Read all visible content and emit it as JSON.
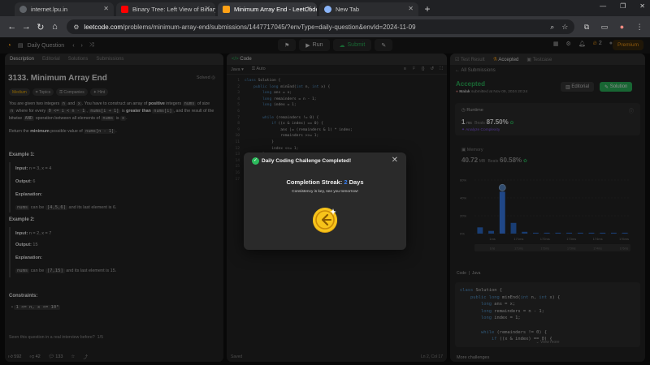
{
  "browser": {
    "tabs": [
      {
        "label": "internet.lpu.in",
        "icon": "globe-icon",
        "color": "#5f6368"
      },
      {
        "label": "Binary Tree: Left View of Binary",
        "icon": "youtube-icon",
        "color": "#ff0000"
      },
      {
        "label": "Minimum Array End - LeetCode",
        "icon": "leetcode-icon",
        "color": "#ffa116",
        "active": true
      },
      {
        "label": "New Tab",
        "icon": "chrome-icon",
        "color": "#8ab4f8"
      }
    ],
    "url_host": "leetcode.com",
    "url_path": "/problems/minimum-array-end/submissions/1447717045/?envType=daily-question&envId=2024-11-09"
  },
  "lc_header": {
    "daily_label": "Daily Question",
    "run_label": "Run",
    "submit_label": "Submit",
    "streak_count": "2",
    "premium_label": "Premium"
  },
  "left_panel": {
    "tabs": [
      "Description",
      "Editorial",
      "Solutions",
      "Submissions"
    ],
    "title": "3133. Minimum Array End",
    "solved_label": "Solved",
    "tags": [
      "Medium",
      "Topics",
      "Companies",
      "Hint"
    ],
    "para1_a": "You are given two integers ",
    "para1_n": "n",
    "para1_b": " and ",
    "para1_x": "x",
    "para1_c": ". You have to construct an array of ",
    "para1_pos": "positive",
    "para1_d": " integers ",
    "para1_nums": "nums",
    "para1_e": " of size ",
    "para1_f": " where for every ",
    "para1_range": "0 <= i < n - 1",
    "para1_g": ", ",
    "para1_ni1": "nums[i + 1]",
    "para1_h": " is ",
    "para1_gt": "greater than",
    "para1_ni": "nums[i]",
    "para1_i": ", and the result of the bitwise ",
    "para1_and": "AND",
    "para1_j": " operation between all elements of ",
    "para1_k": " is ",
    "para1_l": ".",
    "para2_a": "Return the ",
    "para2_min": "minimum",
    "para2_b": " possible value of ",
    "para2_code": "nums[n - 1]",
    "para2_c": ".",
    "ex1_title": "Example 1:",
    "ex1_input_label": "Input:",
    "ex1_input": "n = 3, x = 4",
    "ex1_output_label": "Output:",
    "ex1_output": "6",
    "ex1_expl_label": "Explanation:",
    "ex1_expl_code1": "nums",
    "ex1_expl_mid": " can be ",
    "ex1_expl_code2": "[4,5,6]",
    "ex1_expl_end": " and its last element is 6.",
    "ex2_title": "Example 2:",
    "ex2_input_label": "Input:",
    "ex2_input": "n = 2, x = 7",
    "ex2_output_label": "Output:",
    "ex2_output": "15",
    "ex2_expl_label": "Explanation:",
    "ex2_expl_code1": "nums",
    "ex2_expl_mid": " can be ",
    "ex2_expl_code2": "[7,15]",
    "ex2_expl_end": " and its last element is 15.",
    "constraints_title": "Constraints:",
    "constraint1": "1 <= n, x <= 10⁸",
    "interview_q": "Seen this question in a real interview before?",
    "interview_page": "1/5",
    "likes": "592",
    "dislikes": "42",
    "comments": "133"
  },
  "mid_panel": {
    "tab_label": "Code",
    "lang": "Java",
    "auto": "Auto",
    "code": [
      "class Solution {",
      "    public long minEnd(int n, int x) {",
      "        long ans = x;",
      "        long remainders = n - 1;",
      "        long index = 1;",
      "",
      "        while (remainders != 0) {",
      "            if ((x & index) == 0) {",
      "                ans |= (remainders & 1) * index;",
      "                remainders >>= 1;",
      "            }",
      "            index <<= 1;",
      "        }",
      "",
      "        return ans;",
      "    }",
      "}"
    ],
    "saved": "Saved",
    "cursor": "Ln 2, Col 17"
  },
  "right_panel": {
    "tabs": [
      "Test Result",
      "Accepted",
      "Testcase"
    ],
    "back_label": "All Submissions",
    "status": "Accepted",
    "author": "Malak",
    "submitted": "submitted at Nov 09, 2024 20:24",
    "editorial_label": "Editorial",
    "solution_label": "Solution",
    "runtime_label": "Runtime",
    "runtime_value": "1",
    "runtime_unit": "ms",
    "beats_label": "Beats",
    "beats_value": "87.50%",
    "analyze_label": "Analyze Complexity",
    "memory_label": "Memory",
    "memory_value": "40.72",
    "memory_unit": "MB",
    "memory_beats": "60.58%",
    "code_tab": "Code",
    "code_lang": "Java",
    "code": [
      "class Solution {",
      "    public long minEnd(int n, int x) {",
      "        long ans = x;",
      "        long remainders = n - 1;",
      "        long index = 1;",
      "",
      "        while (remainders != 0) {",
      "            if ((x & index) == 0) {"
    ],
    "view_more": "View more",
    "more_challenges": "More challenges"
  },
  "chart_data": {
    "type": "bar",
    "y_ticks": [
      "60%",
      "40%",
      "20%",
      "0%"
    ],
    "x_ticks": [
      "1ms",
      "171ms",
      "172ms",
      "173ms",
      "174ms",
      "176ms"
    ],
    "ylim": [
      0,
      60
    ],
    "values": [
      7,
      3,
      47,
      12,
      2,
      1,
      1,
      1,
      1,
      1,
      1,
      1,
      1,
      1
    ]
  },
  "modal": {
    "title": "Daily Coding Challenge Completed!",
    "streak_label": "Completion Streak:",
    "streak_value": "2",
    "streak_unit": "Days",
    "subtitle": "Consistency is key, see you tomorrow!",
    "coin_color": "#f7c31a"
  }
}
